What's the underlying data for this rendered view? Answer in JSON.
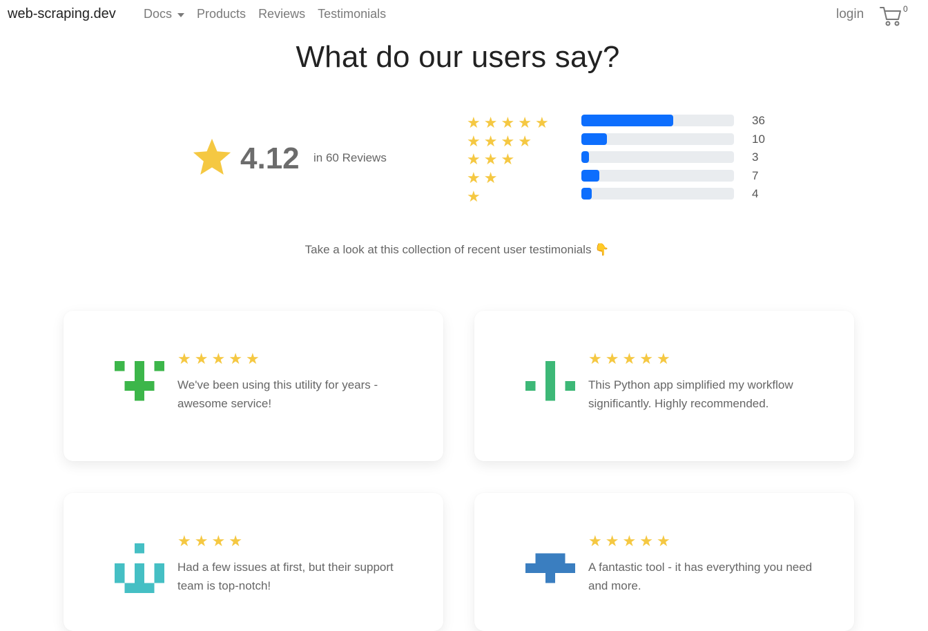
{
  "nav": {
    "brand": "web-scraping.dev",
    "links": [
      "Docs",
      "Products",
      "Reviews",
      "Testimonials"
    ],
    "login": "login",
    "cart_count": "0"
  },
  "heading": "What do our users say?",
  "summary": {
    "average": "4.12",
    "review_count_text": "in 60 Reviews",
    "distribution": [
      {
        "stars": 5,
        "count": 36
      },
      {
        "stars": 4,
        "count": 10
      },
      {
        "stars": 3,
        "count": 3
      },
      {
        "stars": 2,
        "count": 7
      },
      {
        "stars": 1,
        "count": 4
      }
    ]
  },
  "subtitle": "Take a look at this collection of recent user testimonials 👇",
  "colors": {
    "star": "#f5c842",
    "bar": "#0d6efd",
    "bar_track": "#e9ecef"
  },
  "testimonials": [
    {
      "stars": 5,
      "text": "We've been using this utility for years - awesome service!",
      "avatar_color": "#3cb64a"
    },
    {
      "stars": 5,
      "text": "This Python app simplified my workflow significantly. Highly recommended.",
      "avatar_color": "#3db877"
    },
    {
      "stars": 4,
      "text": "Had a few issues at first, but their support team is top-notch!",
      "avatar_color": "#45bfc4"
    },
    {
      "stars": 5,
      "text": "A fantastic tool - it has everything you need and more.",
      "avatar_color": "#3a7ec0"
    }
  ]
}
